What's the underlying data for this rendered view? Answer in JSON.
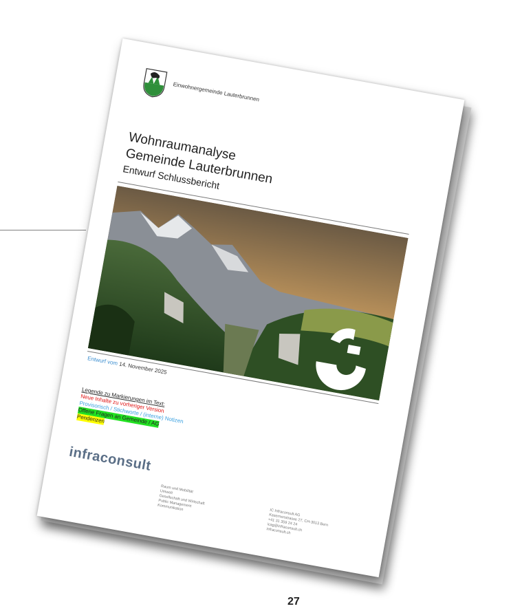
{
  "document": {
    "municipality": "Einwohnergemeinde Lauterbrunnen",
    "title_line1": "Wohnraumanalyse",
    "title_line2": "Gemeinde Lauterbrunnen",
    "subtitle": "Entwurf Schlussbericht",
    "draft_label": "Entwurf vom",
    "draft_date": "14. November 2025",
    "legend": {
      "title": "Legende zu Markierungen im Text:",
      "new_content": "Neue Inhalte zu vorheriger Version",
      "provisional": "Provisorisch / Stichworte / (interne) Notizen",
      "open_questions": "Offene Fragen an Gemeinde / AG",
      "pending": "Pendenzen"
    },
    "brand": "infraconsult",
    "services": [
      "Raum und Mobilität",
      "Umwelt",
      "Gesellschaft und Wirtschaft",
      "Public Management",
      "Kommunikation"
    ],
    "address": [
      "IC Infraconsult AG",
      "Kasernenstrasse 27, CH-3013 Bern",
      "+41 31 359 24 24",
      "icag@infraconsult.ch",
      "infraconsult.ch"
    ]
  },
  "page_number": "27",
  "colors": {
    "new_content": "#e01010",
    "provisional": "#3aa0e0",
    "open_questions_bg": "#22e022",
    "pending_bg": "#ffff00",
    "brand": "#5a6e86"
  }
}
